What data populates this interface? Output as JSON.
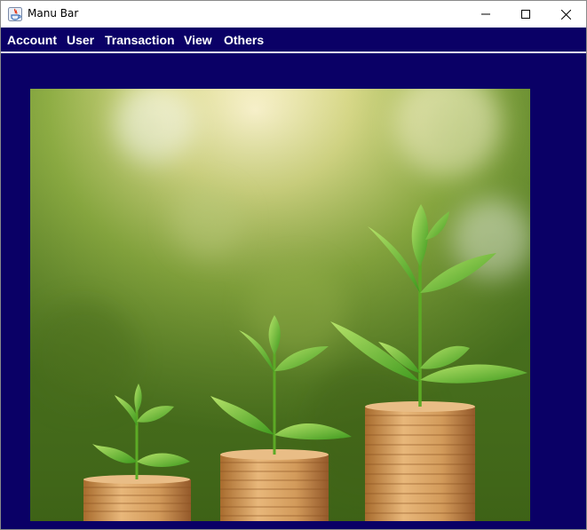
{
  "window": {
    "title": "Manu Bar",
    "controls": {
      "minimize_icon": "minimize-icon",
      "maximize_icon": "maximize-icon",
      "close_icon": "close-icon"
    }
  },
  "menubar": {
    "items": [
      {
        "label": "Account"
      },
      {
        "label": "User"
      },
      {
        "label": "Transaction"
      },
      {
        "label": "View"
      },
      {
        "label": "Others"
      }
    ]
  },
  "content": {
    "image": {
      "subject": "stacks of coins with green sprouts growing on top, bokeh green background"
    }
  },
  "colors": {
    "menubar_bg": "#0a0066",
    "content_bg": "#0a0066",
    "menu_text": "#ffffff",
    "titlebar_bg": "#ffffff"
  }
}
